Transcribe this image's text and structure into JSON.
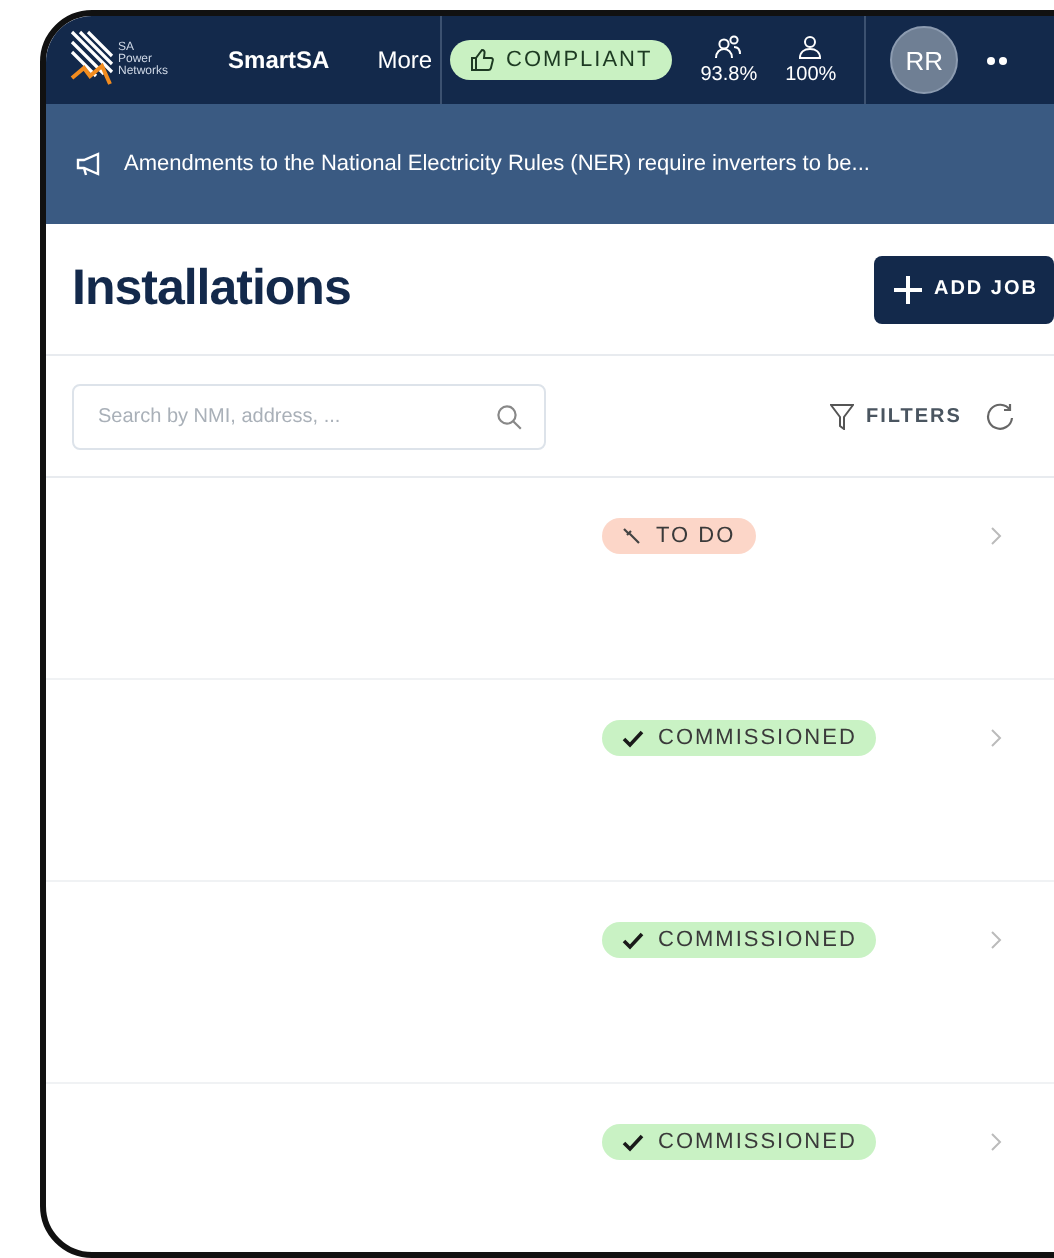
{
  "top_bar": {
    "logo_lines": [
      "SA",
      "Power",
      "Networks"
    ],
    "app_name": "SmartSA",
    "menu": "More",
    "compliance_badge": "COMPLIANT",
    "stats": [
      {
        "kind": "team",
        "value": "93.8%"
      },
      {
        "kind": "user",
        "value": "100%"
      }
    ],
    "avatar": "RR"
  },
  "banner": {
    "text": "Amendments to the National Electricity Rules (NER) require inverters to be..."
  },
  "header": {
    "title": "Installations",
    "add_button": "ADD JOB"
  },
  "toolbar": {
    "search": {
      "placeholder": "Search by NMI, address, ..."
    },
    "filters": "FILTERS"
  },
  "jobs": [
    {
      "kind": "todo",
      "status": "TO DO"
    },
    {
      "kind": "commissioned",
      "status": "COMMISSIONED"
    },
    {
      "kind": "commissioned",
      "status": "COMMISSIONED"
    },
    {
      "kind": "commissioned",
      "status": "COMMISSIONED"
    }
  ]
}
